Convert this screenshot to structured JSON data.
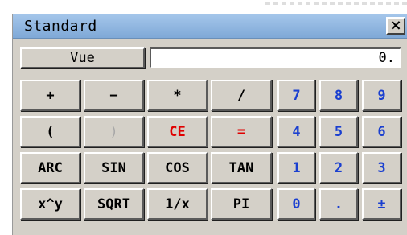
{
  "window": {
    "title": "Standard",
    "close_label": "×"
  },
  "mode_button": {
    "label": "Vue"
  },
  "display": {
    "value": "0."
  },
  "operators": {
    "plus": "+",
    "minus": "−",
    "multiply": "*",
    "divide": "/",
    "open_paren": "(",
    "close_paren": ")",
    "clear_entry": "CE",
    "equals": "="
  },
  "functions": {
    "arc": "ARC",
    "sin": "SIN",
    "cos": "COS",
    "tan": "TAN",
    "power": "x^y",
    "sqrt": "SQRT",
    "reciprocal": "1/x",
    "pi": "PI"
  },
  "digits": {
    "d7": "7",
    "d8": "8",
    "d9": "9",
    "d4": "4",
    "d5": "5",
    "d6": "6",
    "d1": "1",
    "d2": "2",
    "d3": "3",
    "d0": "0",
    "decimal": ".",
    "sign": "±"
  },
  "colors": {
    "digit": "#1a3fd0",
    "accent_red": "#e00000",
    "disabled": "#a8a8a8",
    "title_bar": "#8fb4de"
  }
}
